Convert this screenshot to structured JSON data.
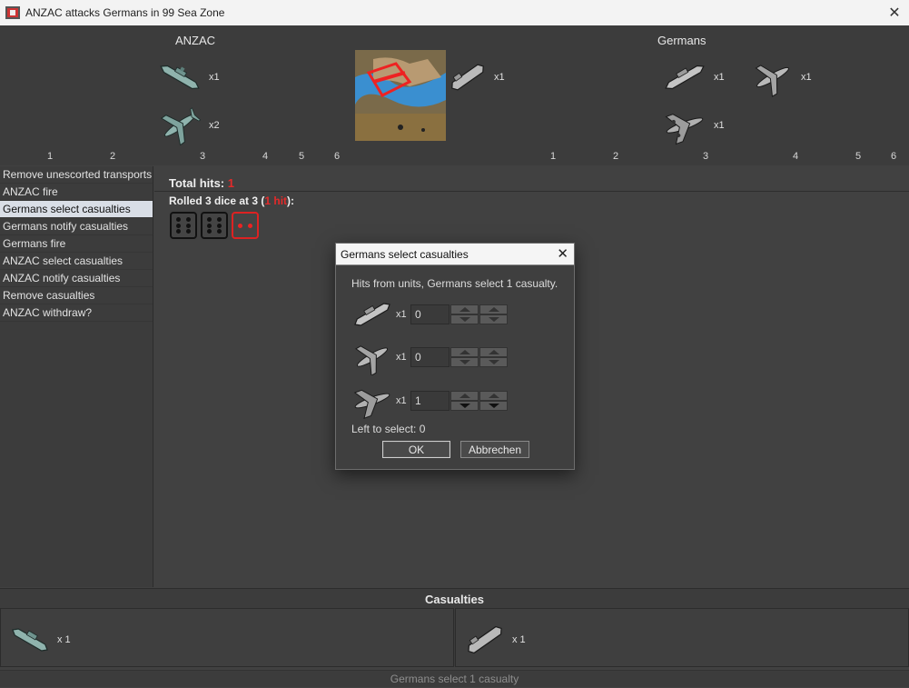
{
  "window": {
    "title": "ANZAC attacks Germans in 99 Sea Zone",
    "app_icon": "flag-icon",
    "close_icon": "close-icon"
  },
  "battle": {
    "attacker": {
      "name": "ANZAC",
      "units": [
        {
          "icon": "battleship-icon",
          "count": "x1"
        },
        {
          "icon": "fighter-plane-icon",
          "count": "x2"
        }
      ],
      "dice_columns": [
        "1",
        "2",
        "3",
        "4",
        "5",
        "6"
      ]
    },
    "defender": {
      "name": "Germans",
      "units": [
        {
          "icon": "battleship-icon",
          "count": "x1"
        },
        {
          "icon": "fighter-plane-icon",
          "count": "x1"
        },
        {
          "icon": "bomber-plane-icon",
          "count": "x1"
        }
      ],
      "transport_unit": {
        "icon": "transport-ship-icon",
        "count": "x1"
      },
      "dice_columns": [
        "1",
        "2",
        "3",
        "4",
        "5",
        "6"
      ]
    },
    "territory_icon": "sea-zone-map-icon"
  },
  "steps": [
    {
      "label": "Remove unescorted transports",
      "selected": false
    },
    {
      "label": "ANZAC fire",
      "selected": false
    },
    {
      "label": "Germans select casualties",
      "selected": true
    },
    {
      "label": "Germans notify casualties",
      "selected": false
    },
    {
      "label": "Germans fire",
      "selected": false
    },
    {
      "label": "ANZAC select casualties",
      "selected": false
    },
    {
      "label": "ANZAC notify casualties",
      "selected": false
    },
    {
      "label": "Remove casualties",
      "selected": false
    },
    {
      "label": "ANZAC withdraw?",
      "selected": false
    }
  ],
  "results": {
    "total_hits_label": "Total hits: ",
    "total_hits_value": "1",
    "rolled_prefix": "Rolled 3 dice at 3 (",
    "rolled_hits": "1 hit",
    "rolled_suffix": "):",
    "dice": [
      {
        "value": 6,
        "hit": false
      },
      {
        "value": 6,
        "hit": false
      },
      {
        "value": 2,
        "hit": true
      }
    ]
  },
  "dialog": {
    "title": "Germans select casualties",
    "message": "Hits from units,  Germans select 1 casualty.",
    "rows": [
      {
        "icon": "battleship-icon",
        "count": "x1",
        "value": "0"
      },
      {
        "icon": "fighter-plane-icon",
        "count": "x1",
        "value": "0"
      },
      {
        "icon": "bomber-plane-icon",
        "count": "x1",
        "value": "1"
      }
    ],
    "left_to_select": "Left to select: 0",
    "ok_label": "OK",
    "cancel_label": "Abbrechen"
  },
  "casualties": {
    "title": "Casualties",
    "attacker": {
      "icon": "battleship-icon",
      "count": "x 1"
    },
    "defender": {
      "icon": "transport-ship-icon",
      "count": "x 1"
    }
  },
  "status": "Germans select 1 casualty",
  "colors": {
    "hit_red": "#e42a2a",
    "anzac_unit": "#8fb3ad",
    "german_unit": "#b9b9b9",
    "selected_row": "#d9dee6"
  }
}
